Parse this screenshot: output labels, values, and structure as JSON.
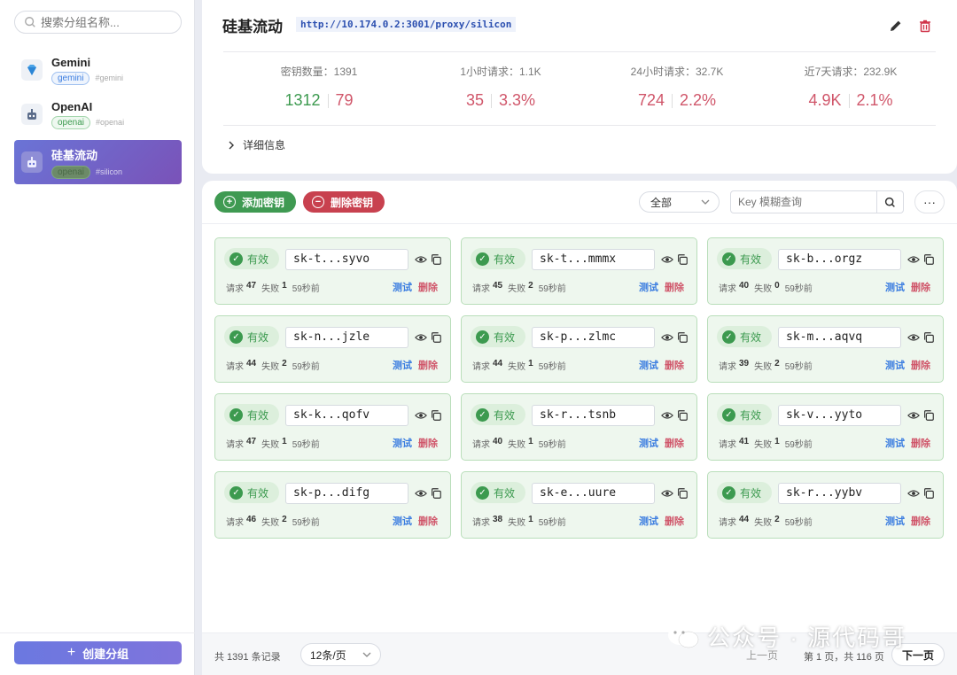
{
  "sidebar": {
    "search_placeholder": "搜索分组名称...",
    "groups": [
      {
        "name": "Gemini",
        "tag": "gemini",
        "id": "#gemini",
        "icon": "gem-icon"
      },
      {
        "name": "OpenAI",
        "tag": "openai",
        "id": "#openai",
        "icon": "robot-icon"
      },
      {
        "name": "硅基流动",
        "tag": "openai",
        "id": "#silicon",
        "icon": "robot-icon"
      }
    ],
    "create_label": "创建分组"
  },
  "header": {
    "title": "硅基流动",
    "proxy_url": "http://10.174.0.2:3001/proxy/silicon",
    "stats": [
      {
        "label": "密钥数量：1391",
        "a": "1312",
        "b": "79"
      },
      {
        "label": "1小时请求：1.1K",
        "a": "35",
        "b": "3.3%"
      },
      {
        "label": "24小时请求：32.7K",
        "a": "724",
        "b": "2.2%"
      },
      {
        "label": "近7天请求：232.9K",
        "a": "4.9K",
        "b": "2.1%"
      }
    ],
    "details_label": "详细信息"
  },
  "toolbar": {
    "add_label": "添加密钥",
    "delete_label": "删除密钥",
    "filter_value": "全部",
    "search_placeholder": "Key 模糊查询"
  },
  "keys": [
    {
      "status": "有效",
      "key": "sk-t...syvo",
      "req": "47",
      "fail": "1",
      "time": "59秒前"
    },
    {
      "status": "有效",
      "key": "sk-t...mmmx",
      "req": "45",
      "fail": "2",
      "time": "59秒前"
    },
    {
      "status": "有效",
      "key": "sk-b...orgz",
      "req": "40",
      "fail": "0",
      "time": "59秒前"
    },
    {
      "status": "有效",
      "key": "sk-n...jzle",
      "req": "44",
      "fail": "2",
      "time": "59秒前"
    },
    {
      "status": "有效",
      "key": "sk-p...zlmc",
      "req": "44",
      "fail": "1",
      "time": "59秒前"
    },
    {
      "status": "有效",
      "key": "sk-m...aqvq",
      "req": "39",
      "fail": "2",
      "time": "59秒前"
    },
    {
      "status": "有效",
      "key": "sk-k...qofv",
      "req": "47",
      "fail": "1",
      "time": "59秒前"
    },
    {
      "status": "有效",
      "key": "sk-r...tsnb",
      "req": "40",
      "fail": "1",
      "time": "59秒前"
    },
    {
      "status": "有效",
      "key": "sk-v...yyto",
      "req": "41",
      "fail": "1",
      "time": "59秒前"
    },
    {
      "status": "有效",
      "key": "sk-p...difg",
      "req": "46",
      "fail": "2",
      "time": "59秒前"
    },
    {
      "status": "有效",
      "key": "sk-e...uure",
      "req": "38",
      "fail": "1",
      "time": "59秒前"
    },
    {
      "status": "有效",
      "key": "sk-r...yybv",
      "req": "44",
      "fail": "2",
      "time": "59秒前"
    }
  ],
  "key_labels": {
    "req": "请求",
    "fail": "失败",
    "test": "测试",
    "remove": "删除"
  },
  "footer": {
    "total": "共 1391 条记录",
    "page_size": "12条/页",
    "prev": "上一页",
    "page_info": "第 1 页，共 116 页",
    "next": "下一页"
  },
  "watermark": "公众号 · 源代码哥"
}
